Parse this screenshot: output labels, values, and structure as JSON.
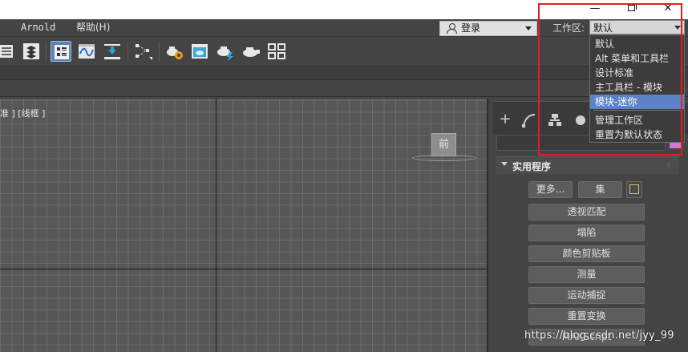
{
  "window": {
    "minimize": "—",
    "maximize": "restore",
    "close": "✕"
  },
  "menubar": {
    "items": [
      "Arnold",
      "帮助(H)"
    ]
  },
  "login": {
    "label": "登录"
  },
  "workspace": {
    "label": "工作区:",
    "selected": "默认",
    "options": [
      "默认",
      "Alt 菜单和工具栏",
      "设计标准",
      "主工具栏 - 模块",
      "模块-迷你",
      "管理工作区",
      "重置为默认状态"
    ],
    "highlighted_option": "模块-迷你"
  },
  "toolbar": {
    "icons": [
      "layer-manager-icon",
      "layer-explorer-icon",
      "schematic-view-icon",
      "curve-editor-icon",
      "dope-sheet-icon",
      "snap-icon",
      "render-setup-icon",
      "render-frame-icon",
      "render-icon",
      "render-iterative-icon",
      "active-shade-icon"
    ]
  },
  "viewport": {
    "label": "准 ] [线框 ]",
    "viewcube_label": "前"
  },
  "command_panel": {
    "tabs": [
      "create-icon",
      "modify-icon",
      "hierarchy-icon",
      "motion-icon"
    ],
    "rollout_title": "实用程序",
    "more_label": "更多...",
    "sets_label": "集",
    "utilities": [
      "透视匹配",
      "塌陷",
      "颜色剪贴板",
      "测量",
      "运动捕捉",
      "重置变换",
      "MAXScript"
    ],
    "swatch_color": "#e070e0"
  },
  "watermark": "https://blog.csdn.net/jyy_99",
  "colors": {
    "selection": "#5b84c7",
    "highlight_frame": "#e02020",
    "toolbar_active": "#5b84b5"
  }
}
